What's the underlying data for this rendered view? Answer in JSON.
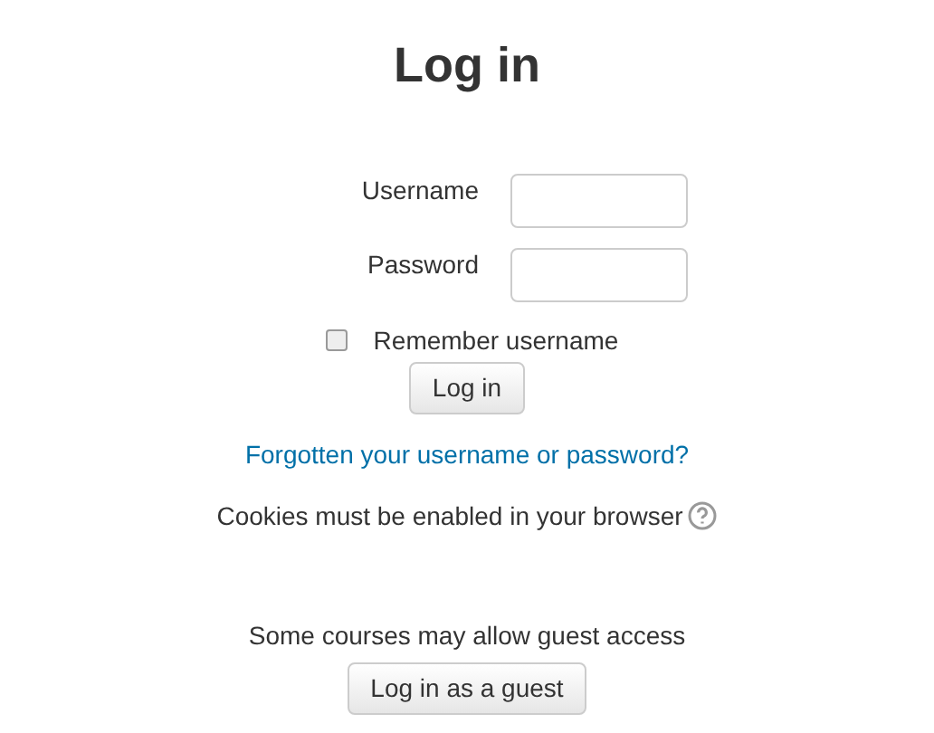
{
  "title": "Log in",
  "fields": [
    {
      "label": "Username"
    },
    {
      "label": "Password"
    }
  ],
  "remember": {
    "label": "Remember username",
    "checked": false
  },
  "login_button": "Log in",
  "forgot_link": "Forgotten your username or password?",
  "cookies_note": "Cookies must be enabled in your browser",
  "guest_note": "Some courses may allow guest access",
  "guest_button": "Log in as a guest"
}
